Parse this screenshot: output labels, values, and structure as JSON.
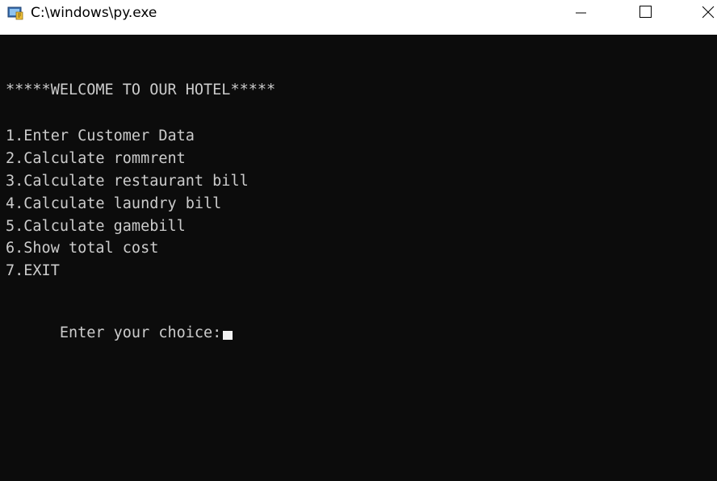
{
  "window": {
    "title": "C:\\windows\\py.exe",
    "controls": {
      "minimize": "minimize-icon",
      "maximize": "maximize-icon",
      "close": "close-icon"
    }
  },
  "console": {
    "background": "#0c0c0c",
    "foreground": "#cccccc",
    "welcome": "*****WELCOME TO OUR HOTEL*****",
    "menu": [
      "1.Enter Customer Data",
      "2.Calculate rommrent",
      "3.Calculate restaurant bill",
      "4.Calculate laundry bill",
      "5.Calculate gamebill",
      "6.Show total cost",
      "7.EXIT"
    ],
    "prompt": "Enter your choice:"
  }
}
